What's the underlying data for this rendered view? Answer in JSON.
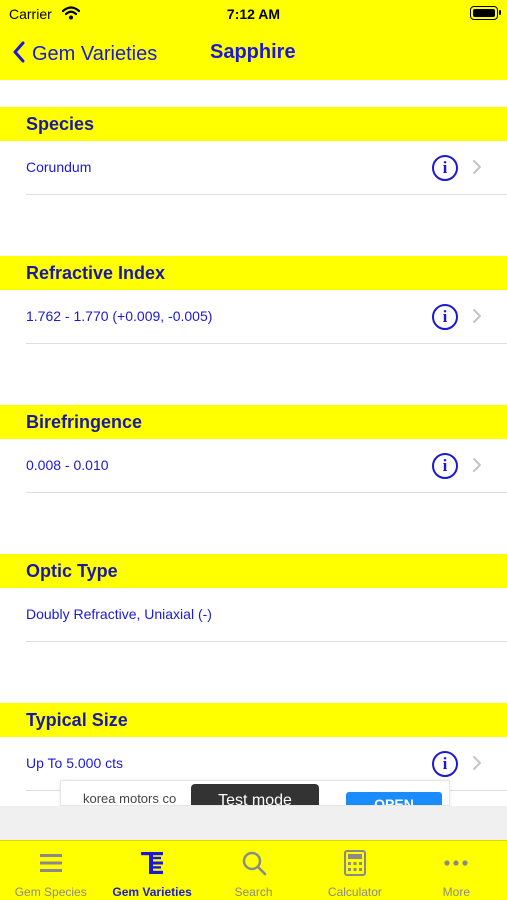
{
  "status_bar": {
    "carrier": "Carrier",
    "time": "7:12 AM"
  },
  "nav": {
    "back_label": "Gem Varieties",
    "title": "Sapphire"
  },
  "sections": [
    {
      "header": "Species",
      "value": "Corundum",
      "has_info": true
    },
    {
      "header": "Refractive Index",
      "value": "1.762 - 1.770 (+0.009, -0.005)",
      "has_info": true
    },
    {
      "header": "Birefringence",
      "value": "0.008 - 0.010",
      "has_info": true
    },
    {
      "header": "Optic Type",
      "value": "Doubly Refractive, Uniaxial (-)",
      "has_info": false
    },
    {
      "header": "Typical Size",
      "value": "Up To 5.000 cts",
      "has_info": true
    }
  ],
  "ad": {
    "text": "korea motors co",
    "test_mode": "Test mode",
    "button": "OPEN"
  },
  "tabs": [
    {
      "label": "Gem Species",
      "icon": "list-icon",
      "active": false
    },
    {
      "label": "Gem Varieties",
      "icon": "varieties-icon",
      "active": true
    },
    {
      "label": "Search",
      "icon": "search-icon",
      "active": false
    },
    {
      "label": "Calculator",
      "icon": "calculator-icon",
      "active": false
    },
    {
      "label": "More",
      "icon": "more-icon",
      "active": false
    }
  ],
  "colors": {
    "accent": "#1a1ad6",
    "bar": "#ffff00",
    "inactive": "#8a8a8a"
  }
}
